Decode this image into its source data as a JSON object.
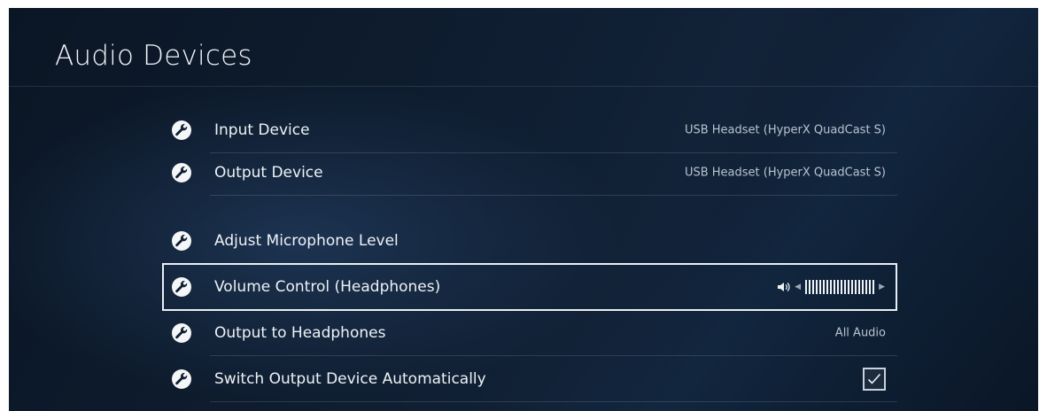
{
  "page": {
    "title": "Audio Devices"
  },
  "icons": {
    "row_icon": "wrench-icon",
    "volume_icon": "speaker-icon",
    "check_icon": "checkmark-icon"
  },
  "colors": {
    "background": "#0f1e31",
    "selection_border": "#e9eef3",
    "text": "#eef2f6",
    "value_text": "#b8c4d0"
  },
  "settings": [
    {
      "label": "Input Device",
      "value": "USB Headset (HyperX QuadCast S)"
    },
    {
      "label": "Output Device",
      "value": "USB Headset (HyperX QuadCast S)"
    },
    {
      "label": "Adjust Microphone Level",
      "value": ""
    },
    {
      "label": "Volume Control (Headphones)",
      "volume_level": 1.0,
      "selected": true
    },
    {
      "label": "Output to Headphones",
      "value": "All Audio"
    },
    {
      "label": "Switch Output Device Automatically",
      "checked": true
    }
  ]
}
